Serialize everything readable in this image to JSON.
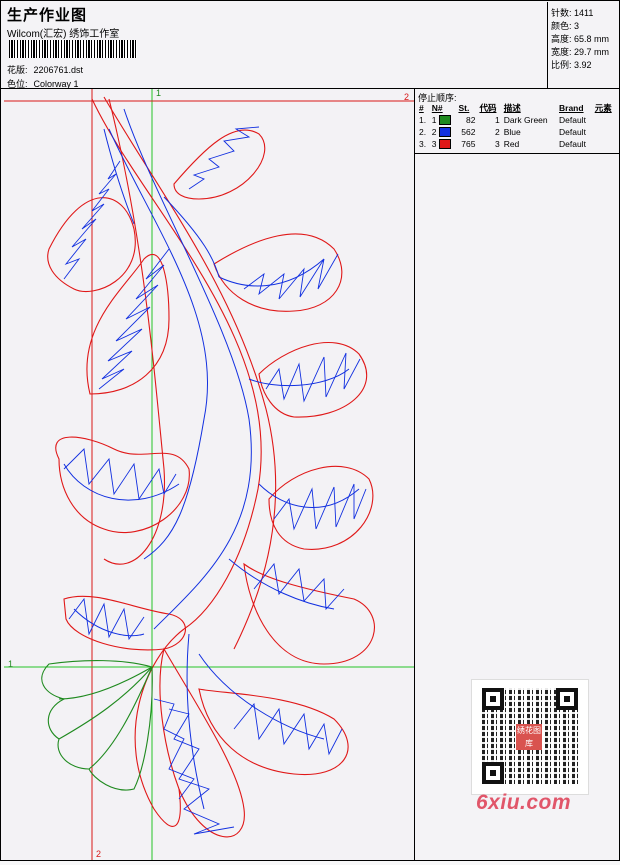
{
  "header": {
    "title": "生产作业图",
    "company": "Wilcom(汇宏) 绣饰工作室",
    "design_label": "花版:",
    "design_value": "2206761.dst",
    "colorway_label": "色位:",
    "colorway_value": "Colorway 1"
  },
  "stats": {
    "stitches": "针数: 1411",
    "colors": "颜色: 3",
    "height": "高度: 65.8 mm",
    "width": "宽度: 29.7 mm",
    "scale": "比例: 3.92"
  },
  "stop_sequence": {
    "title": "停止顺序:",
    "columns": [
      "#",
      "N#",
      "St.",
      "代码",
      "描述",
      "Brand",
      "元素"
    ],
    "rows": [
      {
        "idx": "1.",
        "n": "1",
        "st": "82",
        "code": "1",
        "desc": "Dark Green",
        "brand": "Default",
        "color": "#1f8a1f"
      },
      {
        "idx": "2.",
        "n": "2",
        "st": "562",
        "code": "2",
        "desc": "Blue",
        "brand": "Default",
        "color": "#1230e0"
      },
      {
        "idx": "3.",
        "n": "3",
        "st": "765",
        "code": "3",
        "desc": "Red",
        "brand": "Default",
        "color": "#e01818"
      }
    ]
  },
  "guides": {
    "top_green": "1",
    "right_red": "2",
    "left_green": "1",
    "bottom_red": "2"
  },
  "qr": {
    "logo_text": "绣花图库"
  },
  "watermark": "6xiu.com",
  "colors": {
    "thread_green": "#1f8a1f",
    "thread_blue": "#1230e0",
    "thread_red": "#e01818",
    "guide_green": "#26c426",
    "guide_red": "#d81818"
  }
}
